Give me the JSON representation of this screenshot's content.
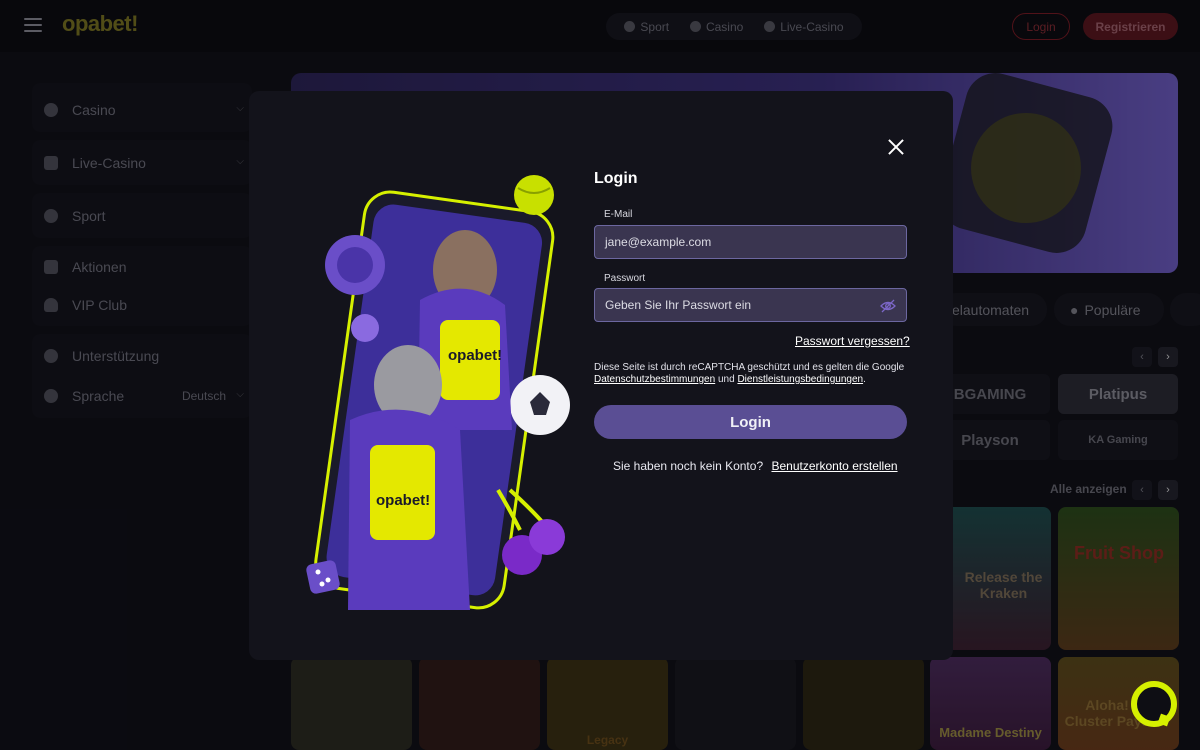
{
  "header": {
    "logo": "opabet!",
    "nav": [
      {
        "label": "Sport",
        "icon": "soccer-ball-icon"
      },
      {
        "label": "Casino",
        "icon": "chip-icon"
      },
      {
        "label": "Live-Casino",
        "icon": "cards-icon"
      }
    ],
    "login_label": "Login",
    "register_label": "Registrieren"
  },
  "sidebar": {
    "items": [
      {
        "label": "Casino",
        "icon": "chip-icon"
      },
      {
        "label": "Live-Casino",
        "icon": "cards-icon"
      },
      {
        "label": "Sport",
        "icon": "soccer-ball-icon"
      },
      {
        "label": "Aktionen",
        "icon": "megaphone-icon"
      },
      {
        "label": "VIP Club",
        "icon": "user-icon"
      },
      {
        "label": "Unterstützung",
        "icon": "support-icon"
      },
      {
        "label": "Sprache",
        "icon": "globe-icon",
        "value": "Deutsch"
      }
    ]
  },
  "background": {
    "chips": [
      "elautomaten",
      "Populäre"
    ],
    "providers": [
      "BGAMING",
      "Platipus",
      "Playson",
      "KA Gaming"
    ],
    "see_all": "Alle anzeigen",
    "games": [
      "Release the Kraken",
      "Fruit Shop",
      "Madame Destiny",
      "Aloha! Cluster Pays",
      "Legacy"
    ]
  },
  "login_modal": {
    "title": "Login",
    "email_label": "E-Mail",
    "email_value": "jane@example.com",
    "password_label": "Passwort",
    "password_placeholder": "Geben Sie Ihr Passwort ein",
    "forgot_password": "Passwort vergessen?",
    "recaptcha_text": "Diese Seite ist durch reCAPTCHA geschützt und es gelten die Google",
    "privacy_link": "Datenschutzbestimmungen",
    "and_text": "und",
    "terms_link": "Dienstleistungsbedingungen",
    "period": ".",
    "submit_label": "Login",
    "no_account_text": "Sie haben noch kein Konto?",
    "create_account_link": "Benutzerkonto erstellen",
    "illustration_brand_1": "opabet!",
    "illustration_brand_2": "opabet!"
  },
  "colors": {
    "accent_purple": "#5a4e94",
    "brand_yellow": "#d6f000",
    "register_red": "#5a141c"
  }
}
